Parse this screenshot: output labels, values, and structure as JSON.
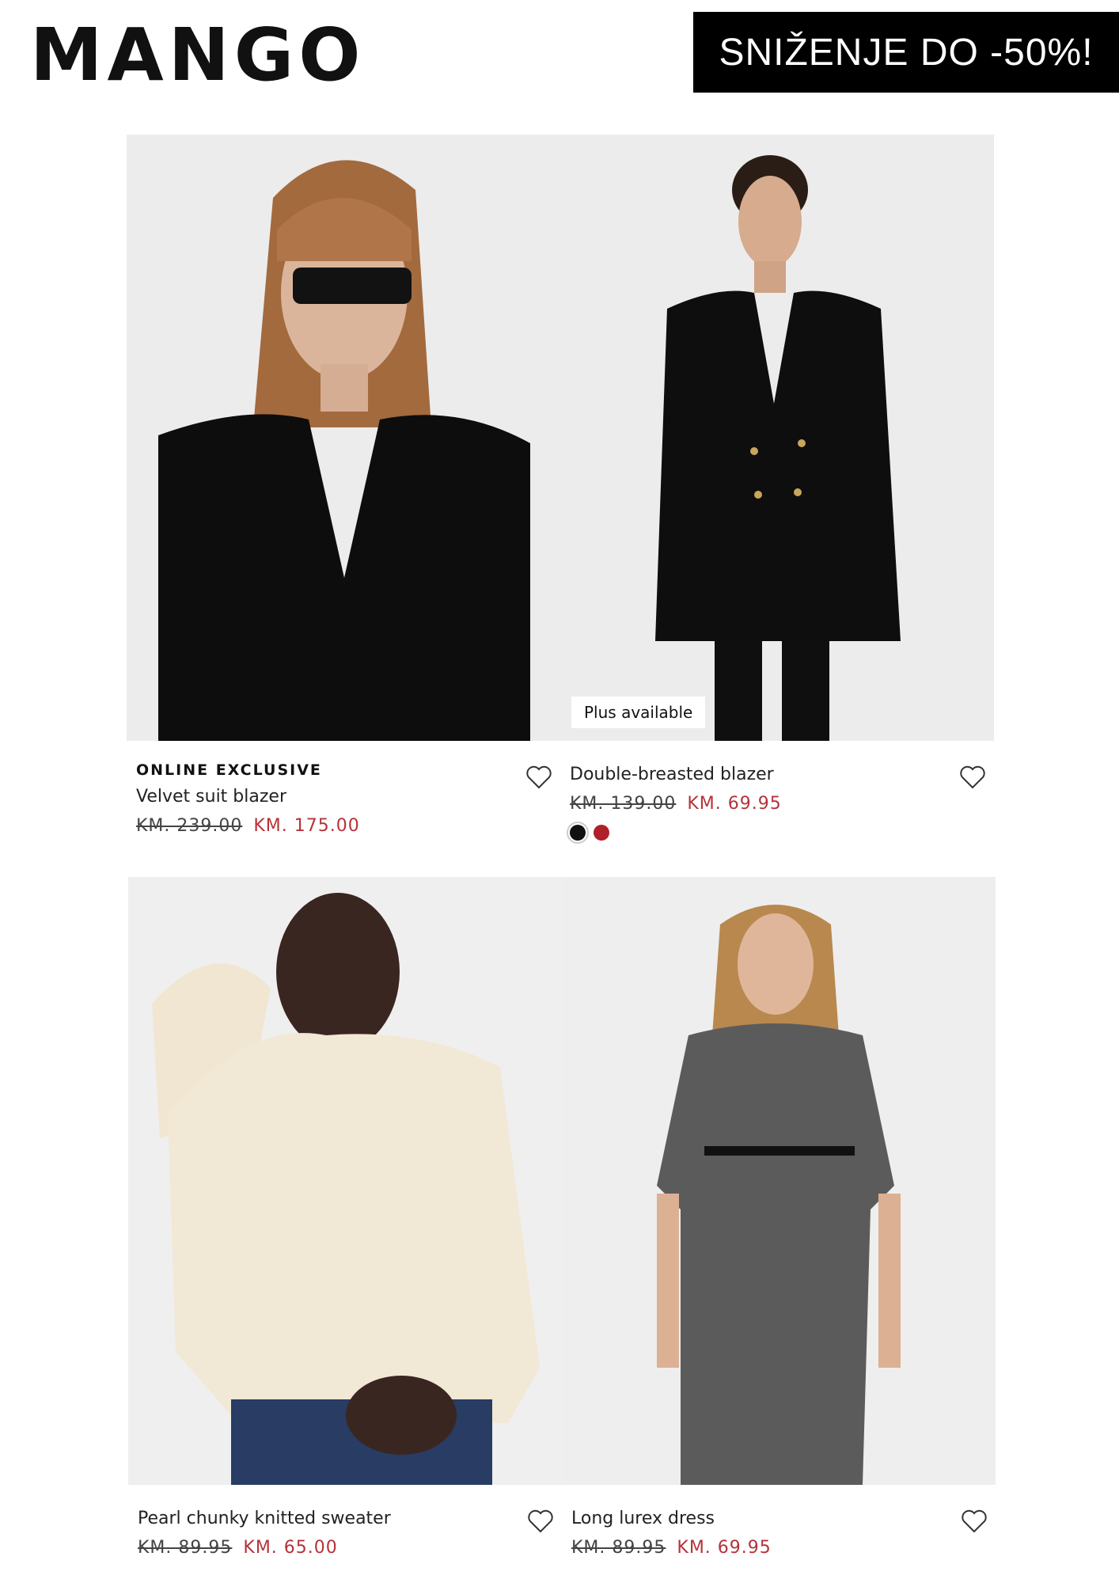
{
  "header": {
    "logo": "MANGO",
    "promo": "SNIŽENJE DO -50%!"
  },
  "products": [
    {
      "tag": "ONLINE EXCLUSIVE",
      "name": "Velvet suit blazer",
      "old_price": "KM. 239.00",
      "new_price": "KM. 175.00"
    },
    {
      "badge": "Plus available",
      "name": "Double-breasted blazer",
      "old_price": "KM. 139.00",
      "new_price": "KM. 69.95",
      "colors": [
        "#111111",
        "#b0202a"
      ]
    },
    {
      "name": "Pearl chunky knitted sweater",
      "old_price": "KM. 89.95",
      "new_price": "KM. 65.00"
    },
    {
      "name": "Long lurex dress",
      "old_price": "KM. 89.95",
      "new_price": "KM. 69.95"
    }
  ],
  "icons": {
    "favorite": "heart-icon"
  },
  "colors": {
    "sale_red": "#b6323a",
    "banner_bg": "#000000"
  }
}
